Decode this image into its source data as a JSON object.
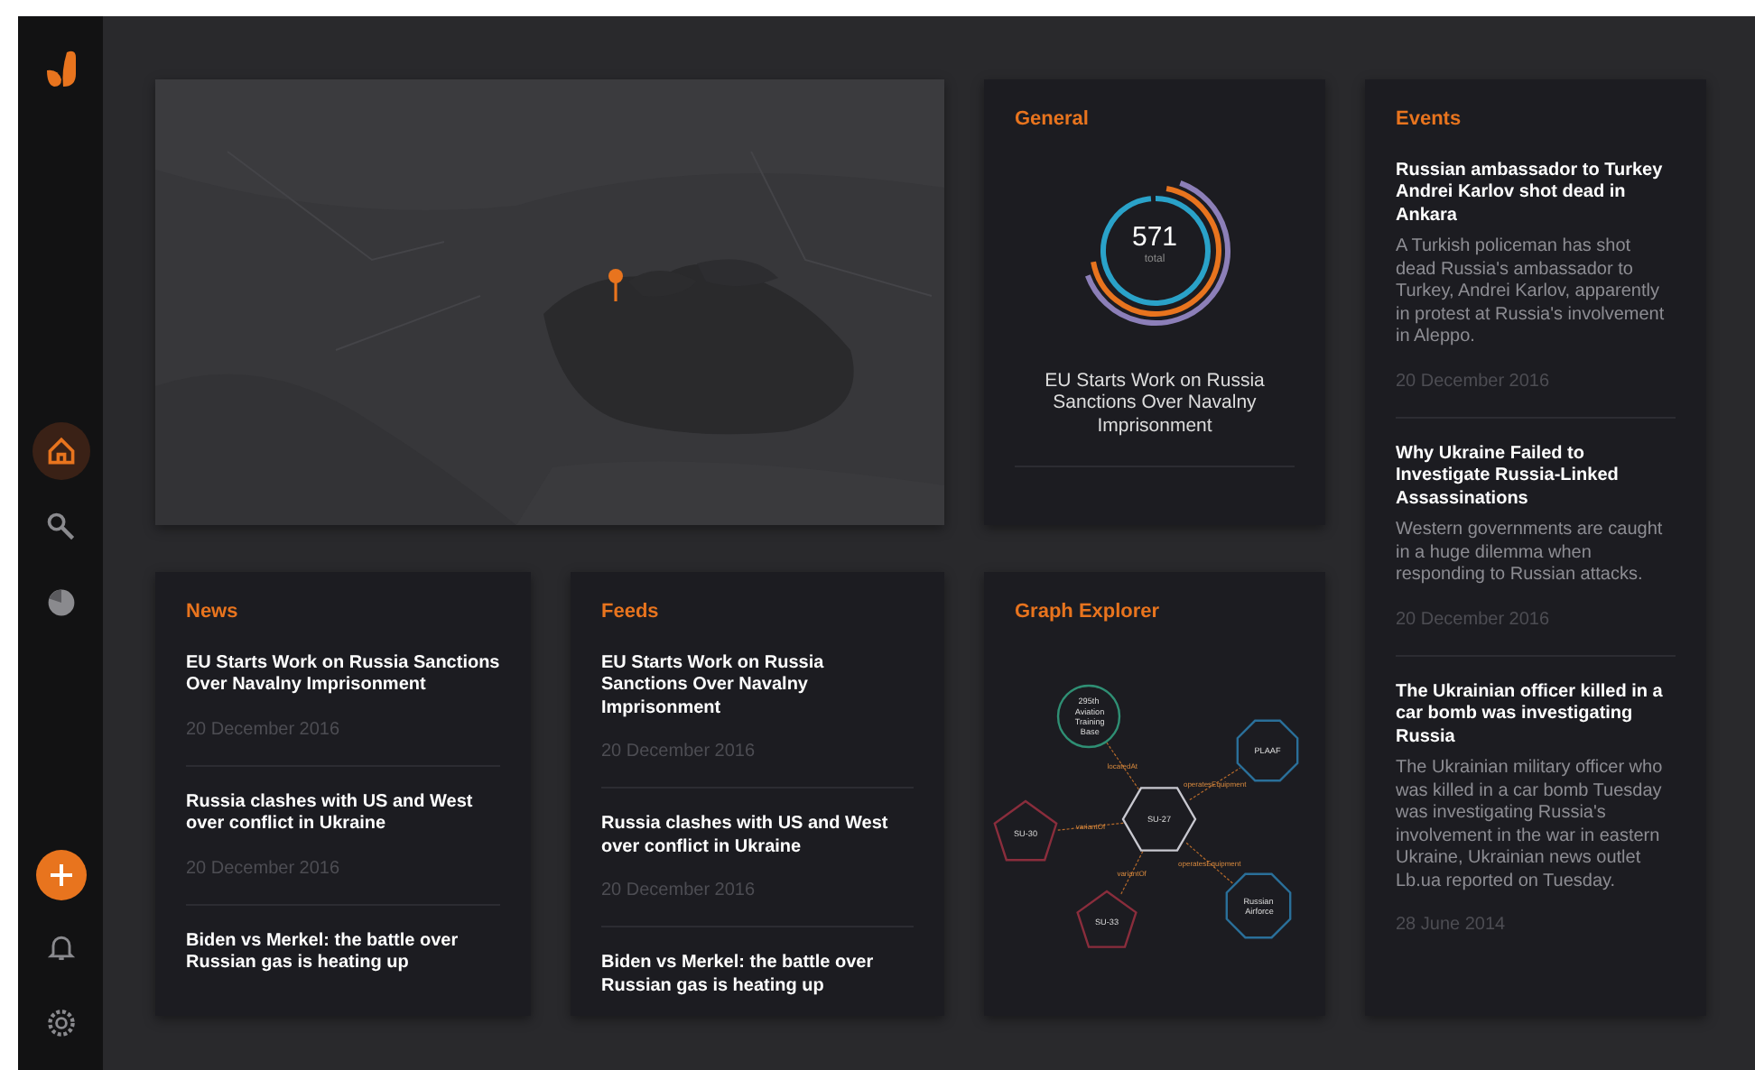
{
  "sidebar": {
    "nav": [
      {
        "kind": "home",
        "selected": true
      },
      {
        "kind": "search",
        "selected": false
      },
      {
        "kind": "chart",
        "selected": false
      }
    ],
    "bottom": [
      {
        "kind": "add"
      },
      {
        "kind": "bell"
      },
      {
        "kind": "settings"
      }
    ]
  },
  "general": {
    "title": "General",
    "total": "571",
    "total_label": "total",
    "headline": "EU Starts Work on Russia Sanctions Over Navalny Imprisonment"
  },
  "events": {
    "title": "Events",
    "items": [
      {
        "headline": "Russian ambassador to Turkey Andrei Karlov shot dead in Ankara",
        "summary": "A Turkish policeman has shot dead Russia's ambassador to Turkey, Andrei Karlov, apparently in protest at Russia's involvement in Aleppo.",
        "date": "20 December 2016"
      },
      {
        "headline": "Why Ukraine Failed to Investigate Russia-Linked Assassinations",
        "summary": "Western governments are caught in a huge dilemma when responding to Russian attacks.",
        "date": "20 December 2016"
      },
      {
        "headline": "The Ukrainian officer killed in a car bomb was investigating Russia",
        "summary": "The Ukrainian military officer who was killed in a car bomb Tuesday was investigating Russia's involvement in the war in eastern Ukraine, Ukrainian news outlet Lb.ua reported on Tuesday.",
        "date": "28 June 2014"
      }
    ]
  },
  "news": {
    "title": "News",
    "items": [
      {
        "headline": "EU Starts Work on Russia Sanctions Over Navalny Imprisonment",
        "date": "20 December 2016"
      },
      {
        "headline": "Russia clashes with US and West over conflict in Ukraine",
        "date": "20 December 2016"
      },
      {
        "headline": "Biden vs Merkel: the battle over Russian gas is heating up"
      }
    ]
  },
  "feeds": {
    "title": "Feeds",
    "items": [
      {
        "headline": "EU Starts Work on Russia Sanctions Over Navalny Imprisonment",
        "date": "20 December 2016"
      },
      {
        "headline": "Russia clashes with US and West over conflict in Ukraine",
        "date": "20 December 2016"
      },
      {
        "headline": "Biden vs Merkel: the battle over Russian gas is heating up"
      }
    ]
  },
  "graph": {
    "title": "Graph Explorer",
    "nodes": [
      {
        "label": "SU-27",
        "kind": "hexagon",
        "color": "#c8c8d0"
      },
      {
        "label": "295th Aviation Training Base",
        "kind": "circle",
        "color": "#2f8f74",
        "link_label": "locatedAt"
      },
      {
        "label": "PLAAF",
        "kind": "octagon",
        "color": "#2a6f99",
        "link_label": "operatesEquipment"
      },
      {
        "label": "SU-30",
        "kind": "pentagon",
        "color": "#8a2d3c",
        "link_label": "variantOf"
      },
      {
        "label": "SU-33",
        "kind": "pentagon",
        "color": "#8a2d3c",
        "link_label": "variantOf"
      },
      {
        "label": "Russian Airforce",
        "kind": "octagon",
        "color": "#2a6f99",
        "link_label": "operatesEquipment"
      }
    ]
  }
}
